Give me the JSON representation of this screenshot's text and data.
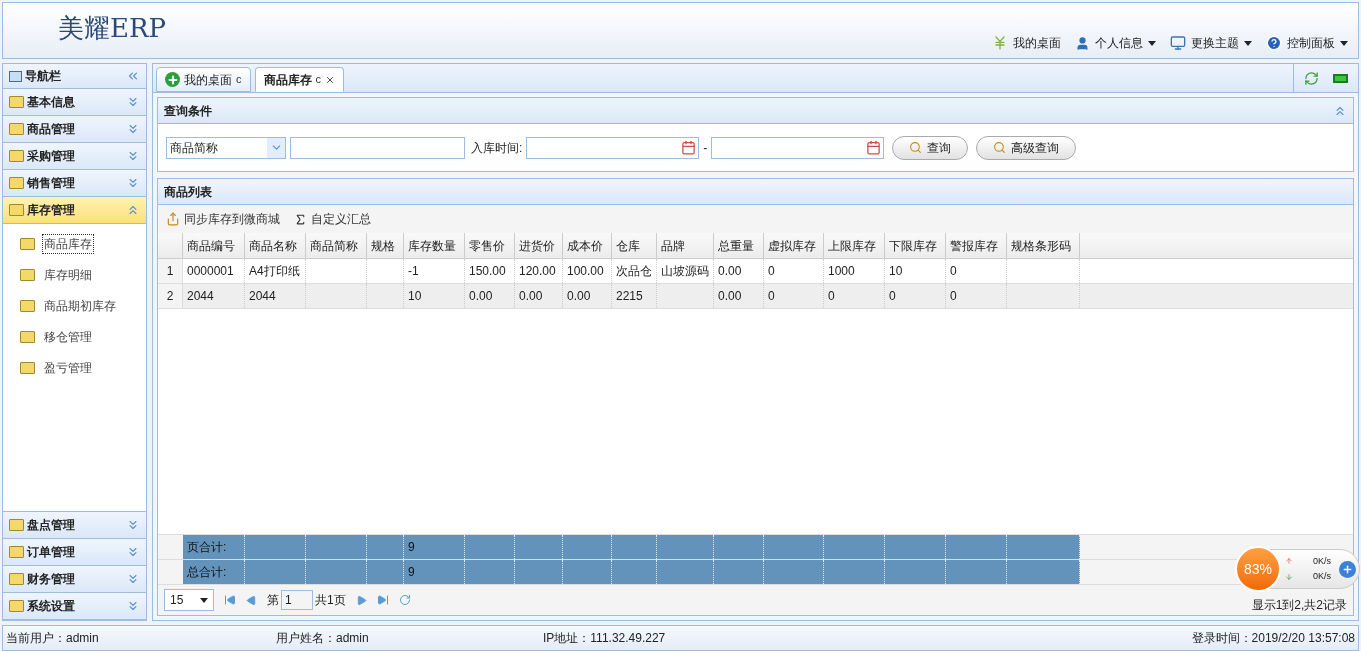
{
  "header": {
    "logo": "美耀ERP",
    "menu": [
      {
        "kind": "desk",
        "label": "我的桌面",
        "dropdown": false
      },
      {
        "kind": "user",
        "label": "个人信息",
        "dropdown": true
      },
      {
        "kind": "theme",
        "label": "更换主题",
        "dropdown": true
      },
      {
        "kind": "help",
        "label": "控制面板",
        "dropdown": true
      }
    ]
  },
  "sidebar": {
    "title": "导航栏",
    "groups": [
      {
        "label": "基本信息",
        "expanded": false
      },
      {
        "label": "商品管理",
        "expanded": false
      },
      {
        "label": "采购管理",
        "expanded": false
      },
      {
        "label": "销售管理",
        "expanded": false
      },
      {
        "label": "库存管理",
        "expanded": true,
        "children": [
          {
            "label": "商品库存",
            "selected": true
          },
          {
            "label": "库存明细",
            "selected": false
          },
          {
            "label": "商品期初库存",
            "selected": false
          },
          {
            "label": "移仓管理",
            "selected": false
          },
          {
            "label": "盈亏管理",
            "selected": false
          }
        ]
      },
      {
        "label": "盘点管理",
        "expanded": false
      },
      {
        "label": "订单管理",
        "expanded": false
      },
      {
        "label": "财务管理",
        "expanded": false
      },
      {
        "label": "系统设置",
        "expanded": false
      }
    ]
  },
  "tabs": [
    {
      "label": "我的桌面",
      "selected": false,
      "closable": false,
      "refresh": "c"
    },
    {
      "label": "商品库存",
      "selected": true,
      "closable": true,
      "refresh": "c"
    }
  ],
  "query": {
    "title": "查询条件",
    "field_select": "商品简称",
    "date_label": "入库时间:",
    "date_separator": "-",
    "buttons": [
      "查询",
      "高级查询"
    ]
  },
  "list": {
    "title": "商品列表",
    "toolbar": [
      {
        "kind": "sync",
        "label": "同步库存到微商城"
      },
      {
        "kind": "sum",
        "label": "自定义汇总"
      }
    ],
    "columns": [
      "商品编号",
      "商品名称",
      "商品简称",
      "规格",
      "库存数量",
      "零售价",
      "进货价",
      "成本价",
      "仓库",
      "品牌",
      "总重量",
      "虚拟库存",
      "上限库存",
      "下限库存",
      "警报库存",
      "规格条形码"
    ],
    "rows": [
      {
        "num": "1",
        "cells": [
          "0000001",
          "A4打印纸",
          "",
          "",
          "-1",
          "150.00",
          "120.00",
          "100.00",
          "次品仓",
          "山坡源码",
          "0.00",
          "0",
          "1000",
          "10",
          "0",
          ""
        ]
      },
      {
        "num": "2",
        "cells": [
          "2044",
          "2044",
          "",
          "",
          "10",
          "0.00",
          "0.00",
          "0.00",
          "2215",
          "",
          "0.00",
          "0",
          "0",
          "0",
          "0",
          ""
        ]
      }
    ],
    "footer": [
      {
        "label": "页合计:",
        "quantity": "9"
      },
      {
        "label": "总合计:",
        "quantity": "9"
      }
    ],
    "pager": {
      "page_size": "15",
      "page_prefix": "第",
      "page": "1",
      "page_suffix": "共1页",
      "summary": "显示1到2,共2记录"
    }
  },
  "status_bar": {
    "current_user": "当前用户：admin",
    "user_name": "用户姓名：admin",
    "ip": "IP地址：111.32.49.227",
    "login_time": "登录时间：2019/2/20 13:57:08"
  },
  "speed_widget": {
    "percent": "83%",
    "upload": "0K/s",
    "download": "0K/s"
  }
}
